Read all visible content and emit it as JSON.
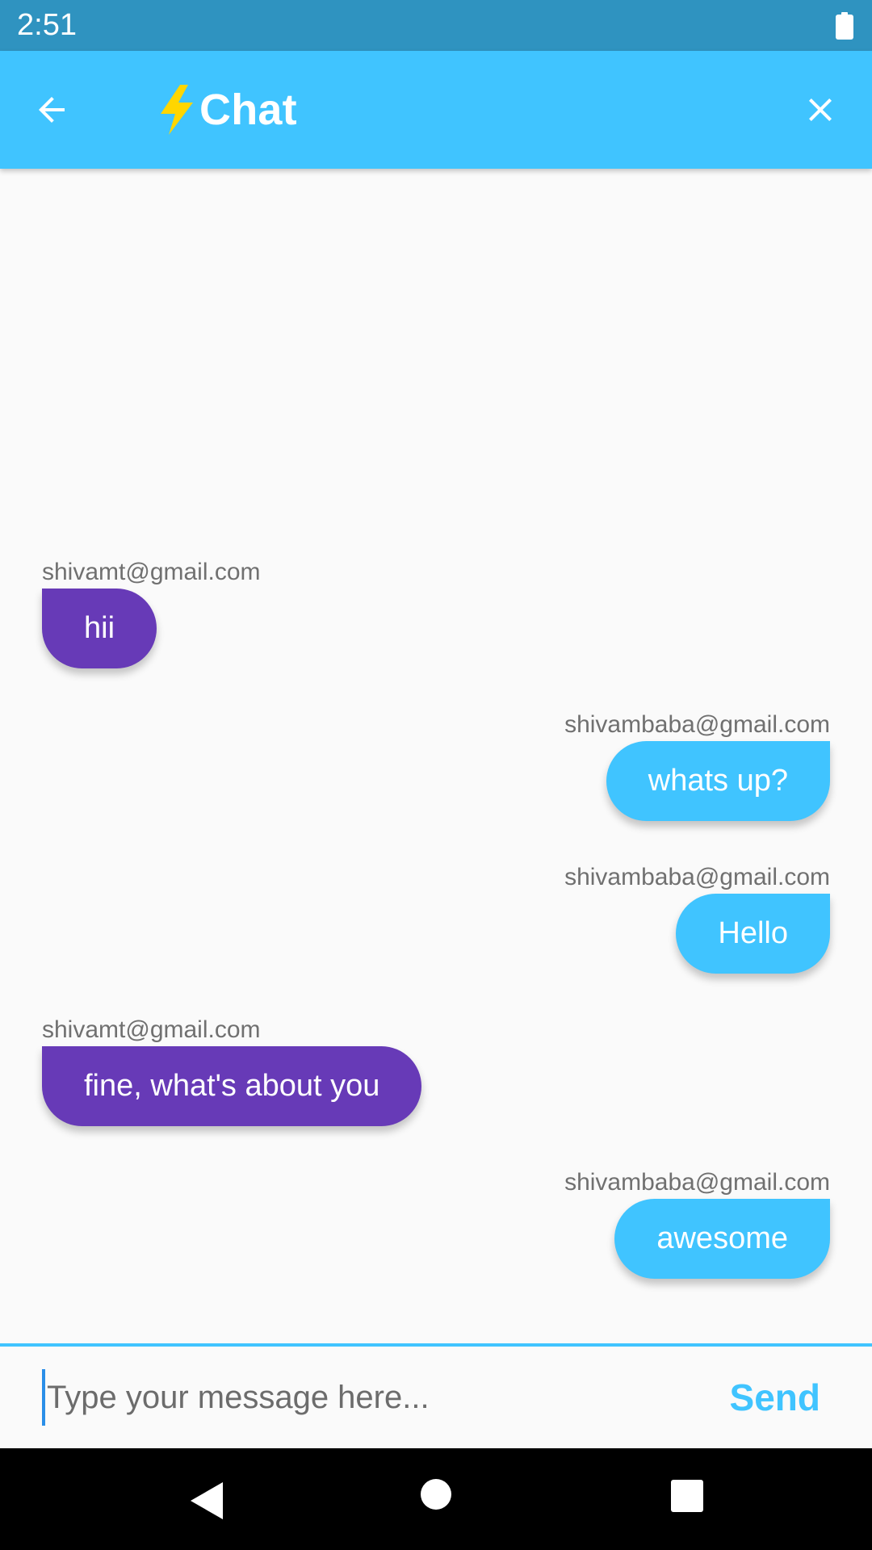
{
  "status_bar": {
    "time": "2:51",
    "battery_icon": "battery-full-icon"
  },
  "app_bar": {
    "title": "Chat",
    "back_icon": "arrow-back-icon",
    "title_icon": "lightning-bolt-icon",
    "close_icon": "close-icon"
  },
  "messages": [
    {
      "sender": "shivamt@gmail.com",
      "text": "hii",
      "is_me": false
    },
    {
      "sender": "shivambaba@gmail.com",
      "text": "whats up?",
      "is_me": true
    },
    {
      "sender": "shivambaba@gmail.com",
      "text": "Hello",
      "is_me": true
    },
    {
      "sender": "shivamt@gmail.com",
      "text": "fine, what's about you",
      "is_me": false
    },
    {
      "sender": "shivambaba@gmail.com",
      "text": "awesome",
      "is_me": true
    }
  ],
  "composer": {
    "placeholder": "Type your message here...",
    "value": "",
    "send_label": "Send"
  },
  "colors": {
    "accent": "#40c4ff",
    "status_bar": "#2f93c0",
    "other_bubble": "#673ab7",
    "my_bubble": "#40c4ff",
    "bolt": "#ffd600"
  },
  "nav_bar": {
    "back_icon": "nav-back-icon",
    "home_icon": "nav-home-icon",
    "recents_icon": "nav-recents-icon"
  }
}
